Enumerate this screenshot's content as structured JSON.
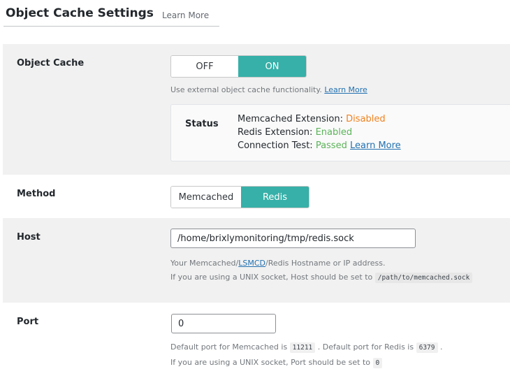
{
  "header": {
    "title": "Object Cache Settings",
    "learn_more": "Learn More"
  },
  "object_cache": {
    "label": "Object Cache",
    "toggle": {
      "off": "OFF",
      "on": "ON",
      "selected": "ON"
    },
    "desc": "Use external object cache functionality.",
    "learn_more": "Learn More",
    "status": {
      "title": "Status",
      "memcached_label": "Memcached Extension:",
      "memcached_value": "Disabled",
      "redis_label": "Redis Extension:",
      "redis_value": "Enabled",
      "conn_label": "Connection Test:",
      "conn_value": "Passed",
      "learn_more": "Learn More"
    }
  },
  "method": {
    "label": "Method",
    "options": [
      "Memcached",
      "Redis"
    ],
    "selected": "Redis"
  },
  "host": {
    "label": "Host",
    "value": "/home/brixlymonitoring/tmp/redis.sock",
    "desc_pre": "Your Memcached/",
    "desc_link": "LSMCD",
    "desc_post": "/Redis Hostname or IP address.",
    "desc2": "If you are using a UNIX socket, Host should be set to",
    "desc2_code": "/path/to/memcached.sock"
  },
  "port": {
    "label": "Port",
    "value": "0",
    "desc_pre": "Default port for Memcached is",
    "memcached_port": "11211",
    "desc_mid": ". Default port for Redis is",
    "redis_port": "6379",
    "desc_end": ".",
    "desc2": "If you are using a UNIX socket, Port should be set to",
    "desc2_code": "0"
  }
}
